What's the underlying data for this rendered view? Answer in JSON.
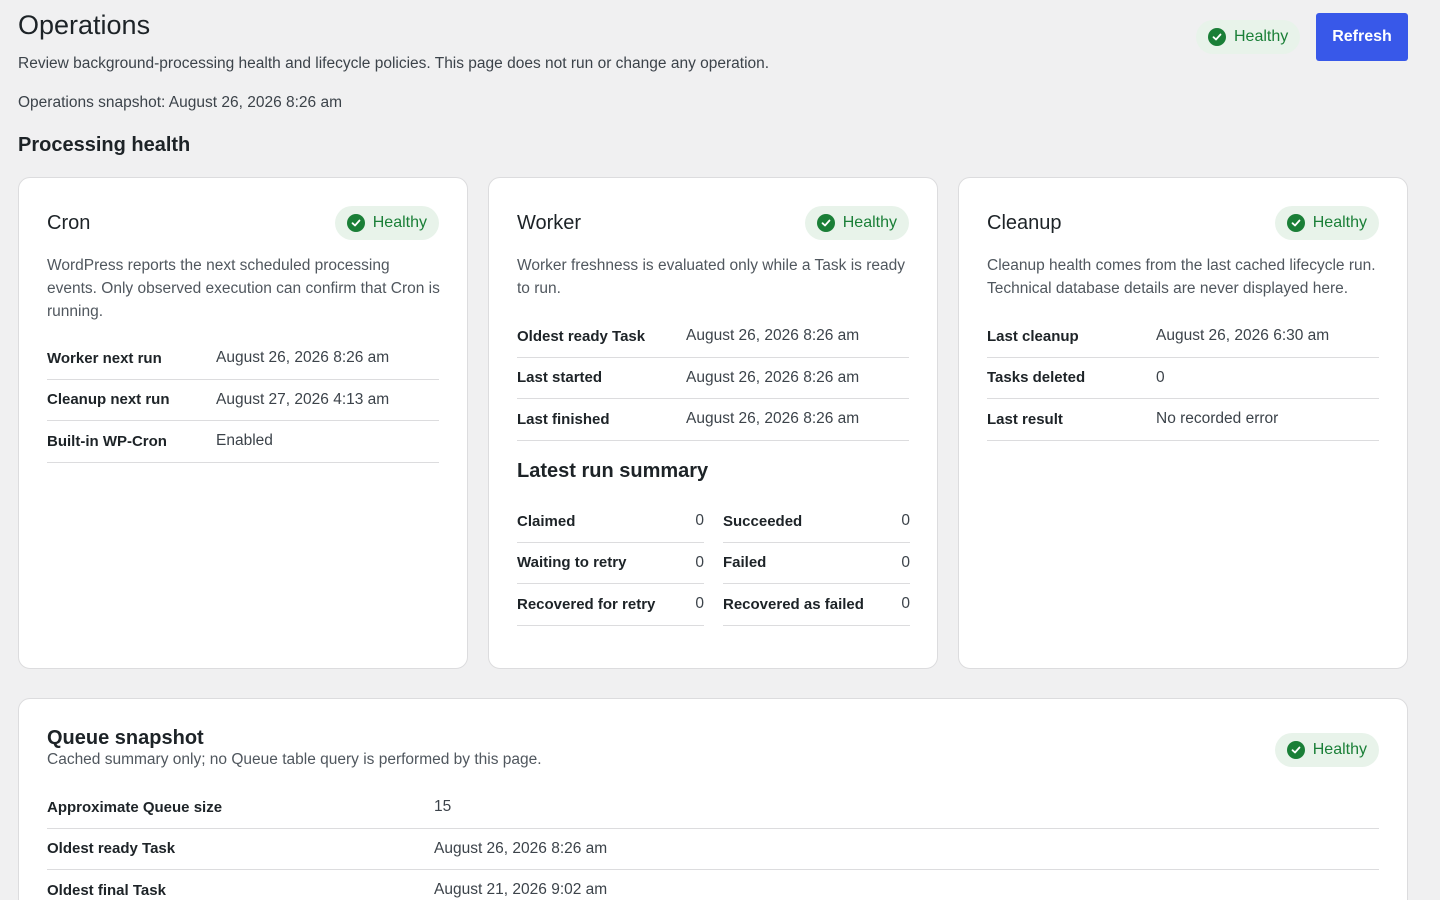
{
  "header": {
    "title": "Operations",
    "description": "Review background-processing health and lifecycle policies. This page does not run or change any operation.",
    "snapshot": "Operations snapshot: August 26, 2026 8:26 am",
    "status": "Healthy",
    "refresh_label": "Refresh"
  },
  "section_title": "Processing health",
  "colors": {
    "accent": "#3858e9",
    "healthy_text": "#1a7f37",
    "healthy_bg": "#e8f3ea"
  },
  "cron": {
    "title": "Cron",
    "status": "Healthy",
    "description": "WordPress reports the next scheduled processing events. Only observed execution can confirm that Cron is running.",
    "rows": [
      {
        "label": "Worker next run",
        "value": "August 26, 2026 8:26 am"
      },
      {
        "label": "Cleanup next run",
        "value": "August 27, 2026 4:13 am"
      },
      {
        "label": "Built-in WP-Cron",
        "value": "Enabled"
      }
    ]
  },
  "worker": {
    "title": "Worker",
    "status": "Healthy",
    "description": "Worker freshness is evaluated only while a Task is ready to run.",
    "rows": [
      {
        "label": "Oldest ready Task",
        "value": "August 26, 2026 8:26 am"
      },
      {
        "label": "Last started",
        "value": "August 26, 2026 8:26 am"
      },
      {
        "label": "Last finished",
        "value": "August 26, 2026 8:26 am"
      }
    ],
    "summary_title": "Latest run summary",
    "summary": [
      {
        "label": "Claimed",
        "value": "0"
      },
      {
        "label": "Succeeded",
        "value": "0"
      },
      {
        "label": "Waiting to retry",
        "value": "0"
      },
      {
        "label": "Failed",
        "value": "0"
      },
      {
        "label": "Recovered for retry",
        "value": "0"
      },
      {
        "label": "Recovered as failed",
        "value": "0"
      }
    ]
  },
  "cleanup": {
    "title": "Cleanup",
    "status": "Healthy",
    "description": "Cleanup health comes from the last cached lifecycle run. Technical database details are never displayed here.",
    "rows": [
      {
        "label": "Last cleanup",
        "value": "August 26, 2026 6:30 am"
      },
      {
        "label": "Tasks deleted",
        "value": "0"
      },
      {
        "label": "Last result",
        "value": "No recorded error"
      }
    ]
  },
  "queue": {
    "title": "Queue snapshot",
    "description": "Cached summary only; no Queue table query is performed by this page.",
    "status": "Healthy",
    "rows": [
      {
        "label": "Approximate Queue size",
        "value": "15"
      },
      {
        "label": "Oldest ready Task",
        "value": "August 26, 2026 8:26 am"
      },
      {
        "label": "Oldest final Task",
        "value": "August 21, 2026 9:02 am"
      }
    ]
  },
  "icons": {
    "status": "check-circle-icon"
  }
}
